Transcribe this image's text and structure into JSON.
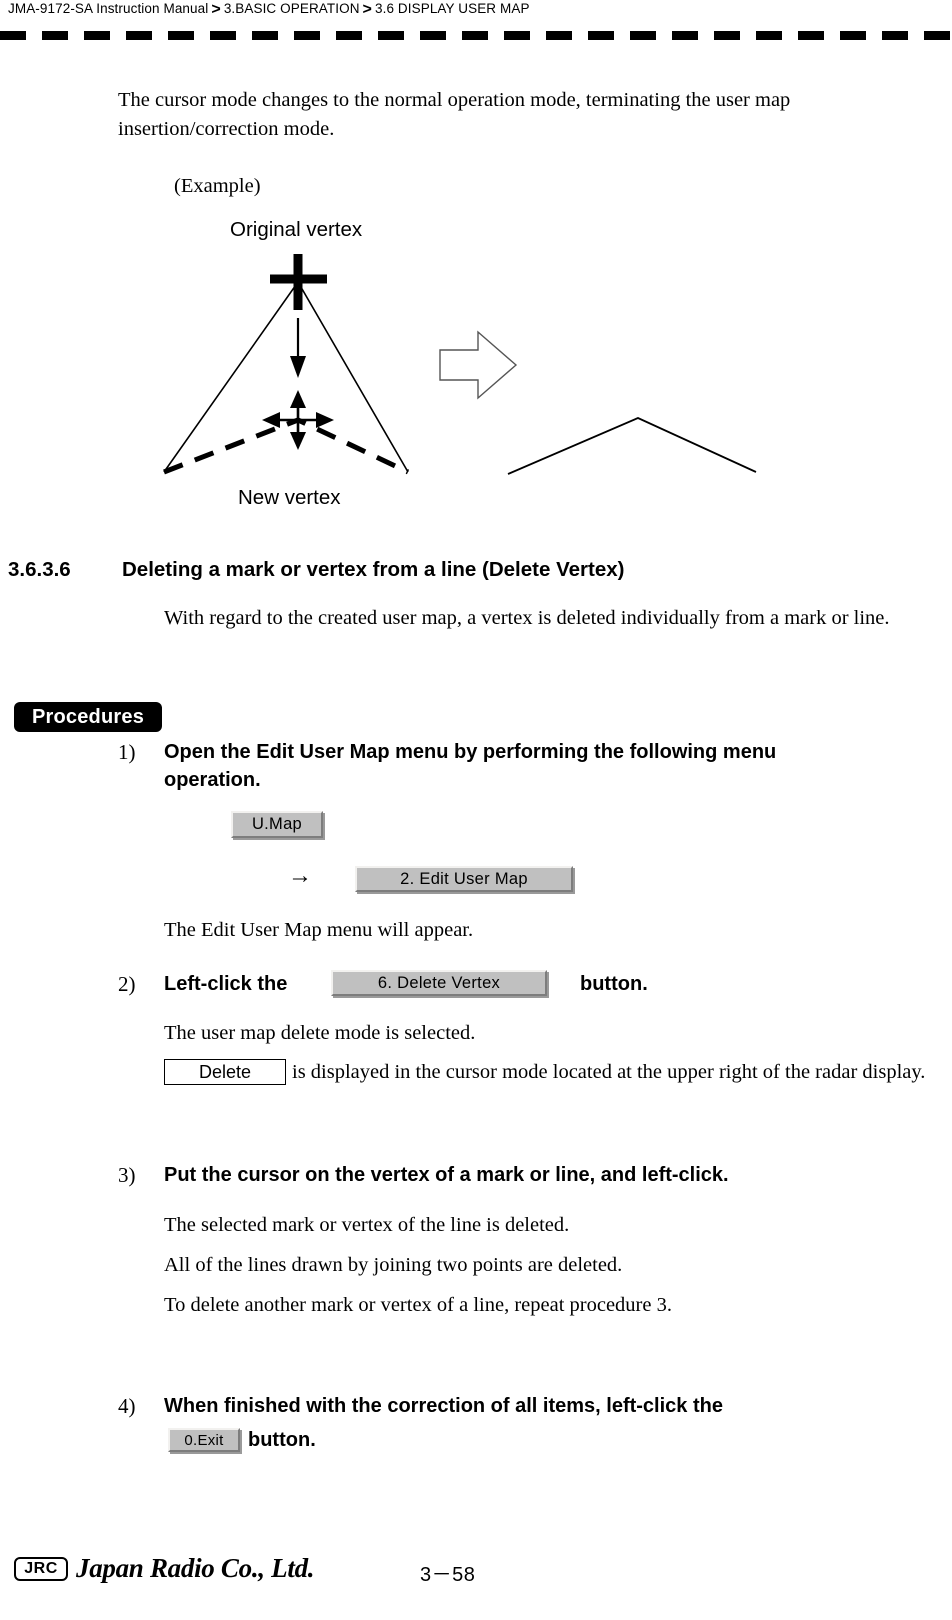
{
  "header": {
    "breadcrumb": [
      "JMA-9172-SA Instruction Manual",
      "3.BASIC OPERATION",
      "3.6  DISPLAY USER MAP"
    ],
    "separator": ">"
  },
  "intro": {
    "paragraph": "The cursor mode changes to the normal operation mode, terminating the user map insertion/correction mode.",
    "example_label": "(Example)"
  },
  "diagram": {
    "original_vertex_label": "Original vertex",
    "new_vertex_label": "New vertex",
    "transition_arrow": "hollow-right-arrow"
  },
  "section": {
    "number": "3.6.3.6",
    "title": "Deleting a mark or vertex from a line (Delete Vertex)",
    "description": "With regard to the created user map, a vertex is deleted individually from a mark or line."
  },
  "procedures": {
    "badge": "Procedures",
    "steps": [
      {
        "number": "1)",
        "title_line1": "Open the Edit User Map menu by performing the following menu",
        "title_line2": "operation.",
        "menu_button_1": "U.Map",
        "menu_arrow": "→",
        "menu_button_2": "2. Edit User Map",
        "result": "The Edit User Map menu will appear."
      },
      {
        "number": "2)",
        "title_prefix": "Left-click the",
        "button": "6. Delete Vertex",
        "title_suffix": "button.",
        "result1": "The user map delete mode is selected.",
        "indicator_box": "Delete",
        "result2": "is displayed in the cursor mode located at the upper right of the radar display."
      },
      {
        "number": "3)",
        "title": "Put the cursor on the vertex of a mark or line, and left-click.",
        "result1": "The selected mark or vertex of the line is deleted.",
        "result2": "All of the lines drawn by joining two points are deleted.",
        "result3": "To delete another mark or vertex of a line, repeat procedure 3."
      },
      {
        "number": "4)",
        "title_line1": "When finished with the correction of all items, left-click the",
        "button": "0.Exit",
        "title_suffix": "button."
      }
    ]
  },
  "footer": {
    "logo_text": "JRC",
    "company": "Japan Radio Co., Ltd.",
    "page_number": "3－58"
  }
}
